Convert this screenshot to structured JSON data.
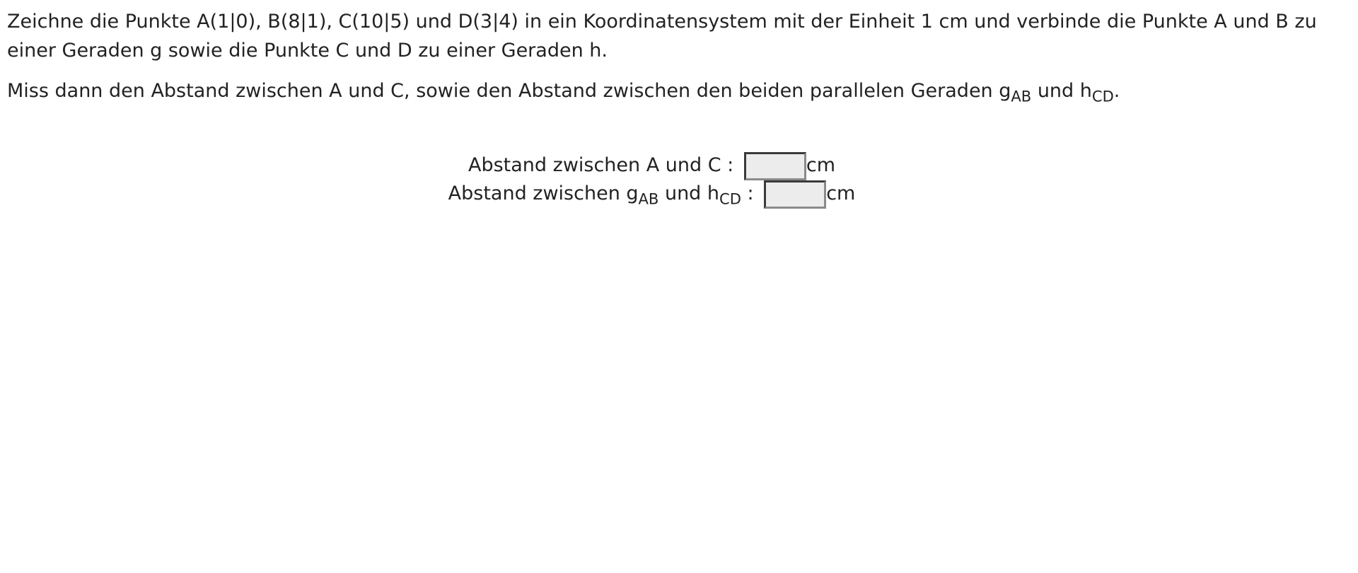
{
  "task": {
    "paragraph1": "Zeichne die Punkte A(1|0), B(8|1), C(10|5) und D(3|4) in ein Koordinatensystem mit der Einheit 1 cm und verbinde die Punkte A und B zu einer Geraden g sowie die Punkte C und D zu einer Geraden h.",
    "paragraph2_before": "Miss dann den Abstand zwischen A und C, sowie den Abstand zwischen den beiden parallelen Geraden g",
    "paragraph2_sub1": "AB",
    "paragraph2_middle": " und h",
    "paragraph2_sub2": "CD",
    "paragraph2_end": "."
  },
  "answers": {
    "row1": {
      "label": "Abstand zwischen A und C : ",
      "value": "",
      "unit": "cm"
    },
    "row2": {
      "label_before": "Abstand zwischen g",
      "sub1": "AB",
      "label_middle": " und h",
      "sub2": "CD",
      "label_end": " : ",
      "value": "",
      "unit": "cm"
    }
  }
}
